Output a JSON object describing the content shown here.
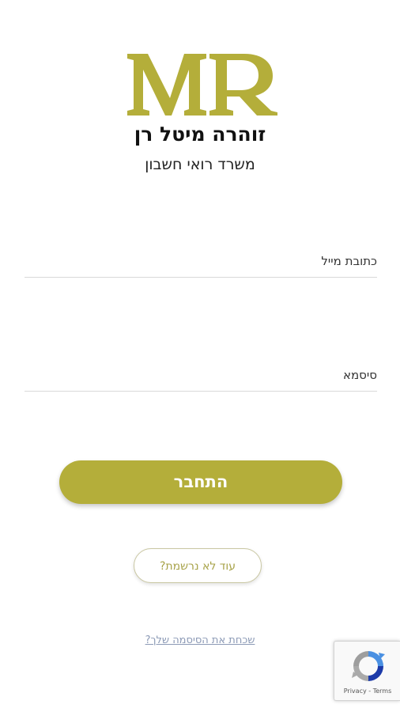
{
  "logo": {
    "text": "MR",
    "icon": "mr-monogram-logo",
    "color": "#b4ae3a"
  },
  "header": {
    "company_name": "זוהרה מיטל רן",
    "subtitle": "משרד רואי חשבון"
  },
  "form": {
    "email_placeholder": "כתובת מייל",
    "email_value": "",
    "password_placeholder": "סיסמא",
    "password_value": "",
    "login_label": "התחבר",
    "register_label": "עוד לא נרשמת?",
    "forgot_label": "שכחת את הסיסמה שלך?"
  },
  "recaptcha": {
    "icon": "recaptcha-icon",
    "privacy": "Privacy",
    "separator": " - ",
    "terms": "Terms"
  },
  "colors": {
    "accent": "#b4ae3a",
    "link": "#8c9ab6"
  }
}
